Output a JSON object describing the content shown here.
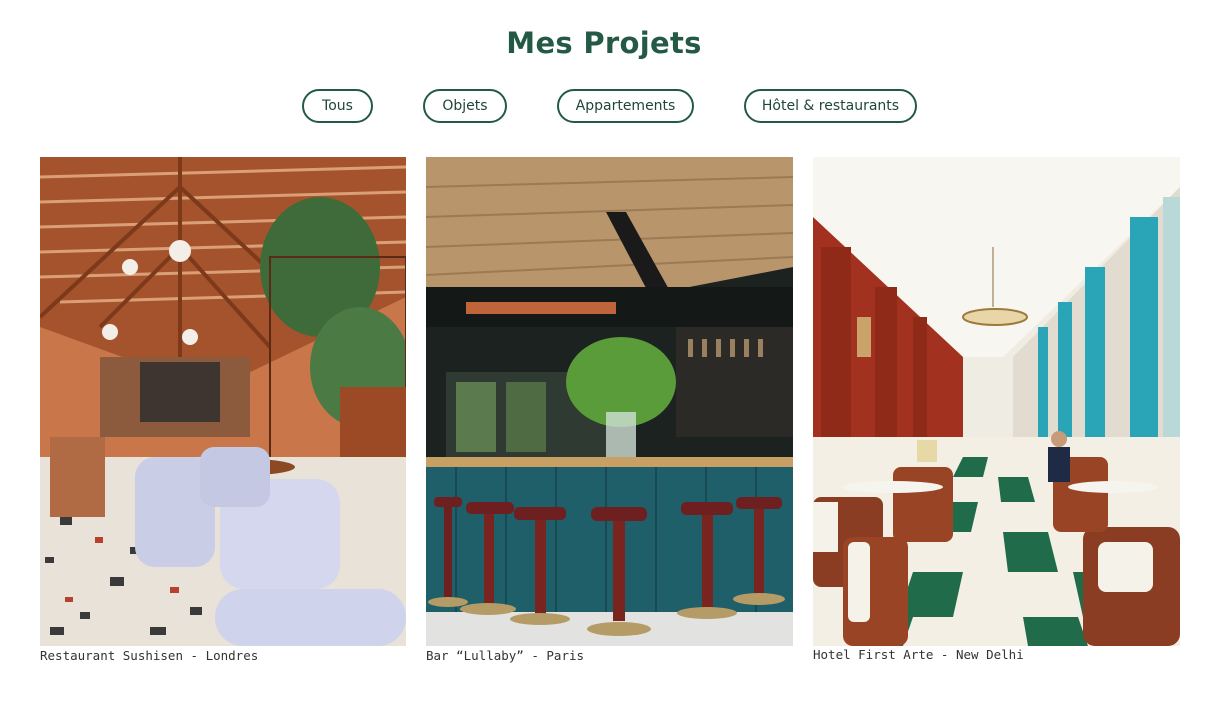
{
  "page": {
    "title": "Mes Projets"
  },
  "filters": [
    {
      "label": "Tous"
    },
    {
      "label": "Objets"
    },
    {
      "label": "Appartements"
    },
    {
      "label": "Hôtel & restaurants"
    }
  ],
  "projects": [
    {
      "caption": "Restaurant Sushisen - Londres"
    },
    {
      "caption": "Bar “Lullaby” - Paris"
    },
    {
      "caption": "Hotel First Arte - New Delhi"
    }
  ],
  "colors": {
    "accent": "#245a45",
    "background": "#ffffff"
  }
}
